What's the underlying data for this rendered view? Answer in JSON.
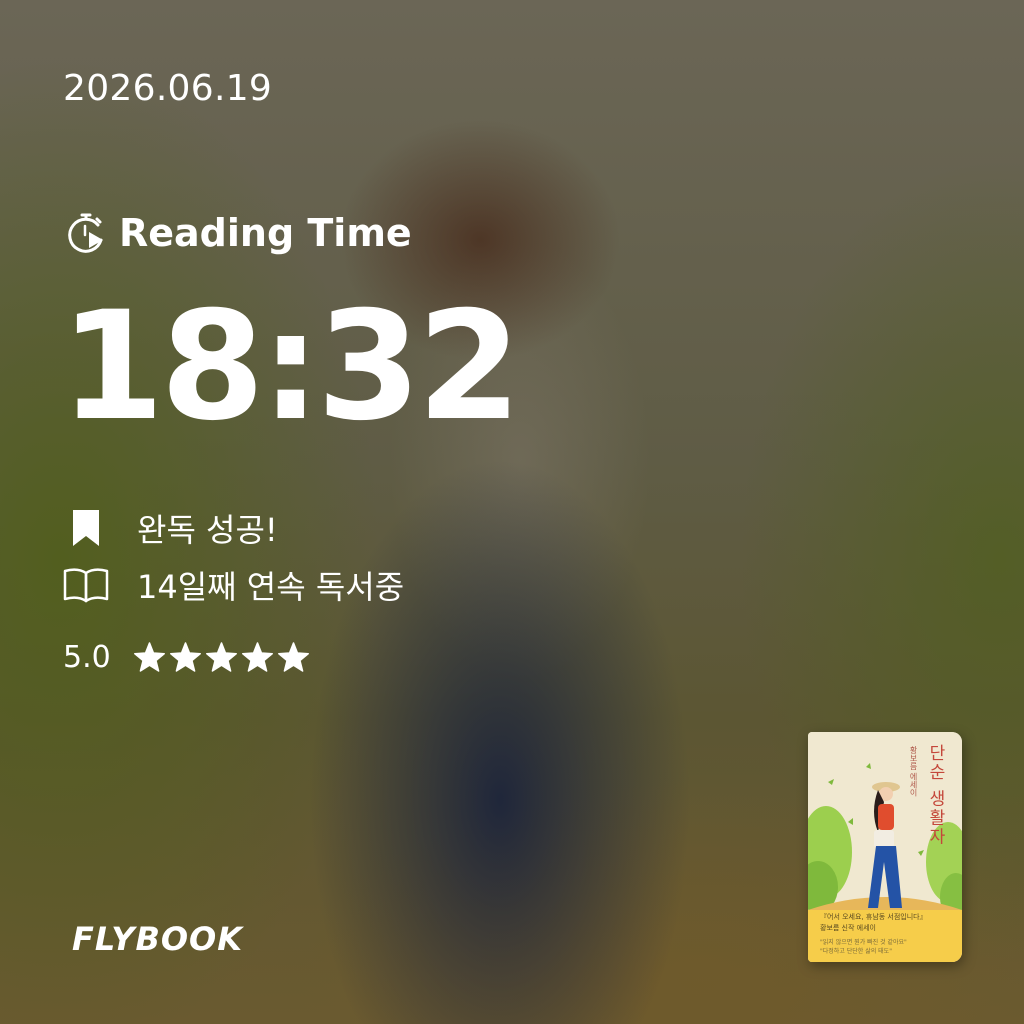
{
  "date": "2026.06.19",
  "reading_time": {
    "label": "Reading Time",
    "icon": "stopwatch-play-icon",
    "value": "18:32"
  },
  "status": {
    "completed": {
      "icon": "bookmark-icon",
      "text": "완독 성공!"
    },
    "streak": {
      "icon": "open-book-icon",
      "text": "14일째 연속 독서중"
    }
  },
  "rating": {
    "value": "5.0",
    "stars_filled": 5,
    "stars_total": 5
  },
  "brand": "FLYBOOK",
  "book_cover": {
    "title": "단순 생활자",
    "author": "황보름 에세이",
    "quote_line1": "『어서 오세요, 휴남동 서점입니다』",
    "quote_line2": "황보름 신작 에세이",
    "quote_line3": "\"읽지 않으면 뭔가 빠진 것 같아요\"",
    "quote_line4": "\"다정하고 단단한 삶의 태도\"",
    "colors": {
      "band": "#f6cd4a",
      "title": "#c4473a",
      "background": "#f0e8d0"
    }
  }
}
